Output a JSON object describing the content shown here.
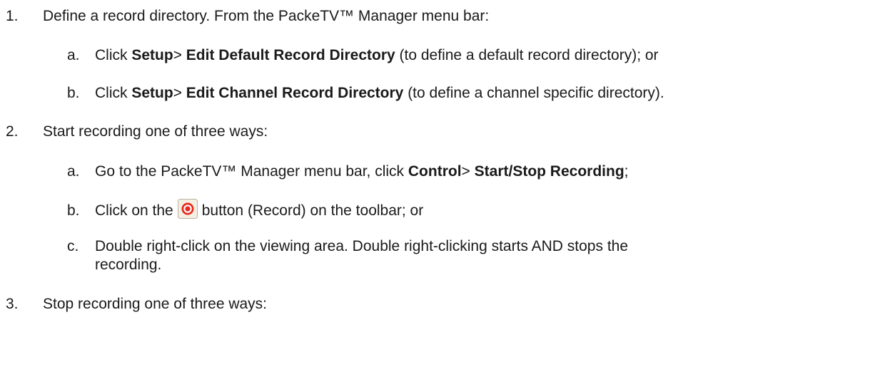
{
  "steps": [
    {
      "num": "1.",
      "text": "Define a record directory. From the PackeTV™ Manager menu bar:",
      "sub": [
        {
          "letter": "a.",
          "pre": "Click ",
          "b1": "Setup",
          "sep": "> ",
          "b2": "Edit Default Record Directory",
          "post": " (to define a default record directory); or"
        },
        {
          "letter": "b.",
          "pre": "Click ",
          "b1": "Setup",
          "sep": "> ",
          "b2": "Edit Channel Record Directory",
          "post": " (to define a channel specific directory)."
        }
      ]
    },
    {
      "num": "2.",
      "text": "Start recording one of three ways:",
      "sub": [
        {
          "letter": "a.",
          "pre": "Go to the PackeTV™ Manager menu bar, click ",
          "b1": "Control",
          "sep": "> ",
          "b2": "Start/Stop Recording",
          "post": ";"
        },
        {
          "letter": "b.",
          "pre": "Click on the",
          "post": "button (Record) on the toolbar; or"
        },
        {
          "letter": "c.",
          "line1": "Double right-click on the viewing area. Double right-clicking starts AND stops the",
          "line2": "recording."
        }
      ]
    },
    {
      "num": "3.",
      "text": "Stop recording one of three ways:"
    }
  ],
  "icons": {
    "record": "record-button-icon",
    "record_color": "#e8281c"
  }
}
